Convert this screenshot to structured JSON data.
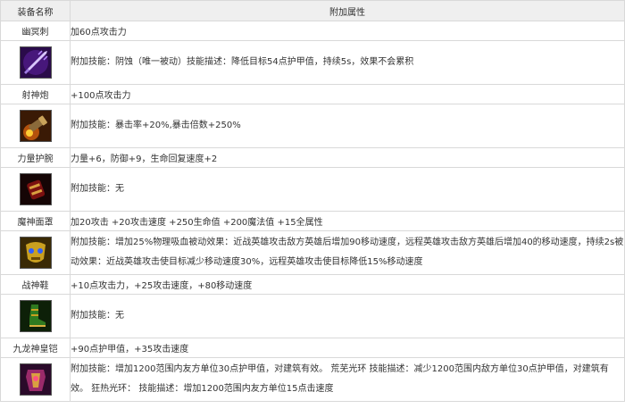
{
  "header": {
    "col_name": "装备名称",
    "col_attr": "附加属性"
  },
  "items": [
    {
      "name": "幽冥刺",
      "attr": "加60点攻击力",
      "icon": "purple-spear-icon",
      "skill": "附加技能：阴蚀（唯一被动）技能描述：降低目标54点护甲值，持续5s，效果不会累积"
    },
    {
      "name": "射神炮",
      "attr": "+100点攻击力",
      "icon": "cannon-icon",
      "skill": "附加技能：暴击率+20%,暴击倍数+250%"
    },
    {
      "name": "力量护腕",
      "attr": "力量+6，防御+9，生命回复速度+2",
      "icon": "bracer-icon",
      "skill": "附加技能：无"
    },
    {
      "name": "魔神面罩",
      "attr": "加20攻击 +20攻击速度 +250生命值 +200魔法值 +15全属性",
      "icon": "golden-mask-icon",
      "skill": "附加技能：增加25%物理吸血被动效果：近战英雄攻击敌方英雄后增加90移动速度，远程英雄攻击敌方英雄后增加40的移动速度，持续2s被动效果：近战英雄攻击使目标减少移动速度30%，远程英雄攻击使目标降低15%移动速度"
    },
    {
      "name": "战神鞋",
      "attr": "+10点攻击力，+25攻击速度，+80移动速度",
      "icon": "boots-icon",
      "skill": "附加技能：无"
    },
    {
      "name": "九龙神皇铠",
      "attr": "+90点护甲值，+35攻击速度",
      "icon": "dragon-armor-icon",
      "skill": "附加技能：增加1200范围内友方单位30点护甲值，对建筑有效。 荒芜光环 技能描述：减少1200范围内敌方单位30点护甲值，对建筑有效。 狂热光环： 技能描述：增加1200范围内友方单位15点击速度"
    }
  ]
}
